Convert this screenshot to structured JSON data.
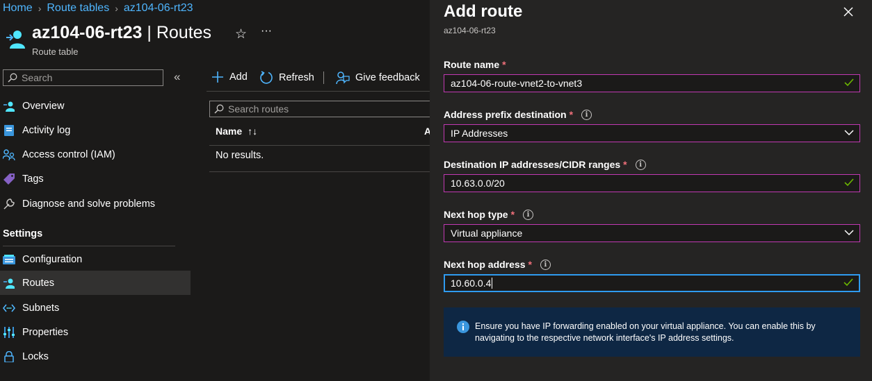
{
  "breadcrumb": {
    "home": "Home",
    "route_tables": "Route tables",
    "current": "az104-06-rt23"
  },
  "header": {
    "name": "az104-06-rt23",
    "separator": "|",
    "section": "Routes",
    "subtitle": "Route table"
  },
  "sidebar": {
    "search_placeholder": "Search",
    "items": [
      {
        "label": "Overview",
        "icon": "overview-icon"
      },
      {
        "label": "Activity log",
        "icon": "activity-log-icon"
      },
      {
        "label": "Access control (IAM)",
        "icon": "iam-icon"
      },
      {
        "label": "Tags",
        "icon": "tag-icon"
      },
      {
        "label": "Diagnose and solve problems",
        "icon": "wrench-icon"
      }
    ],
    "settings_title": "Settings",
    "settings_items": [
      {
        "label": "Configuration",
        "icon": "configuration-icon"
      },
      {
        "label": "Routes",
        "icon": "routes-icon",
        "active": true
      },
      {
        "label": "Subnets",
        "icon": "subnets-icon"
      },
      {
        "label": "Properties",
        "icon": "properties-icon"
      },
      {
        "label": "Locks",
        "icon": "lock-icon"
      }
    ]
  },
  "toolbar": {
    "add": "Add",
    "refresh": "Refresh",
    "feedback": "Give feedback"
  },
  "routes": {
    "search_placeholder": "Search routes",
    "col_name": "Name",
    "col_next": "A",
    "empty": "No results."
  },
  "panel": {
    "title": "Add route",
    "subtitle": "az104-06-rt23",
    "route_name_label": "Route name",
    "route_name_value": "az104-06-route-vnet2-to-vnet3",
    "address_prefix_label": "Address prefix destination",
    "address_prefix_value": "IP Addresses",
    "dest_label": "Destination IP addresses/CIDR ranges",
    "dest_value": "10.63.0.0/20",
    "next_hop_type_label": "Next hop type",
    "next_hop_type_value": "Virtual appliance",
    "next_hop_address_label": "Next hop address",
    "next_hop_address_value": "10.60.0.4",
    "required_mark": "*",
    "info_text": "Ensure you have IP forwarding enabled on your virtual appliance. You can enable this by navigating to the respective network interface's IP address settings."
  },
  "colors": {
    "link": "#4fb6ff",
    "required": "#f1707b",
    "invalid_border": "#c239b3",
    "focus_border": "#2f9bf0",
    "valid_check": "#6bb700"
  }
}
